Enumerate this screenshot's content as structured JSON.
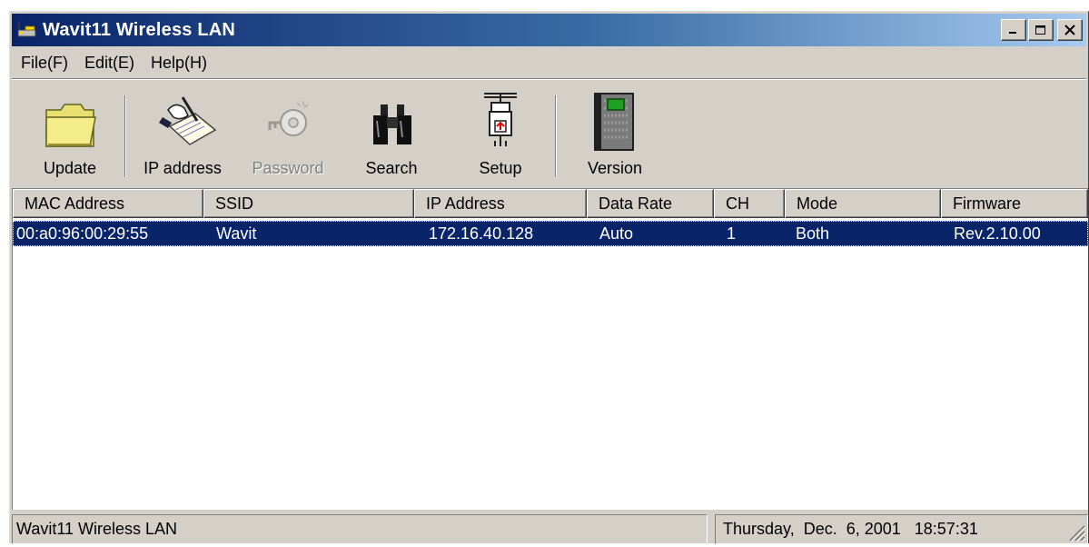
{
  "window": {
    "title": "Wavit11 Wireless LAN",
    "controls": {
      "minimize": "minimize-icon",
      "maximize": "maximize-icon",
      "close": "close-icon"
    }
  },
  "menu": [
    "File(F)",
    "Edit(E)",
    "Help(H)"
  ],
  "toolbar": {
    "update": {
      "label": "Update",
      "icon": "folder-icon",
      "enabled": true
    },
    "ip_address": {
      "label": "IP address",
      "icon": "notepad-hand-icon",
      "enabled": true
    },
    "password": {
      "label": "Password",
      "icon": "key-icon",
      "enabled": false
    },
    "search": {
      "label": "Search",
      "icon": "binoculars-icon",
      "enabled": true
    },
    "setup": {
      "label": "Setup",
      "icon": "network-plug-icon",
      "enabled": true
    },
    "version": {
      "label": "Version",
      "icon": "book-icon",
      "enabled": true
    }
  },
  "table": {
    "columns": [
      "MAC Address",
      "SSID",
      "IP Address",
      "Data Rate",
      "CH",
      "Mode",
      "Firmware"
    ],
    "rows": [
      {
        "mac": "00:a0:96:00:29:55",
        "ssid": "Wavit",
        "ip": "172.16.40.128",
        "rate": "Auto",
        "ch": "1",
        "mode": "Both",
        "firmware": "Rev.2.10.00",
        "selected": true
      }
    ]
  },
  "status": {
    "left": "Wavit11 Wireless LAN",
    "datetime": "Thursday,  Dec.  6, 2001   18:57:31"
  },
  "colors": {
    "title_gradient_start": "#0a246a",
    "title_gradient_end": "#a6caf0",
    "face": "#d4d0c8",
    "selection": "#0a246a"
  }
}
